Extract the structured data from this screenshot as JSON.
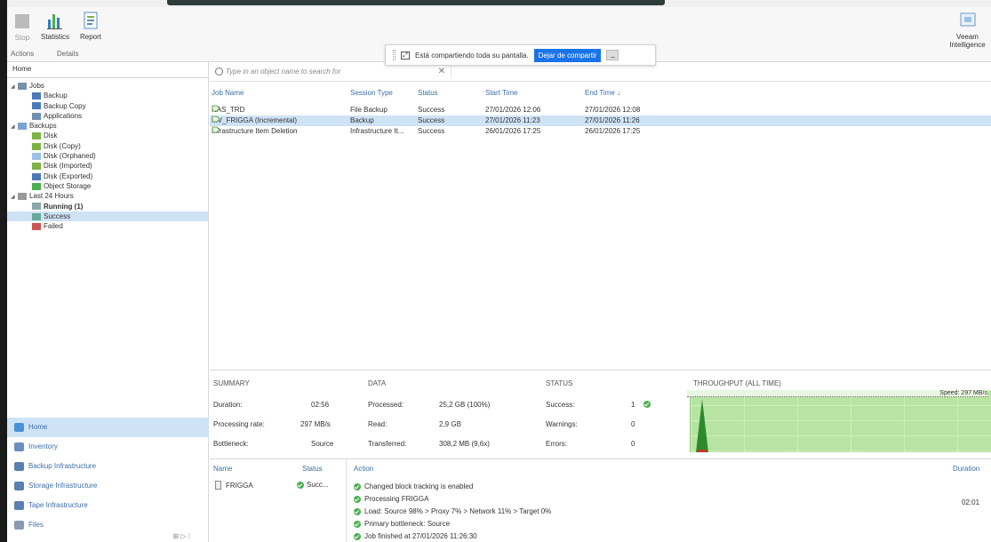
{
  "ribbon": {
    "stop_label": "Stop",
    "statistics_label": "Statistics",
    "report_label": "Report",
    "group_actions": "Actions",
    "group_details": "Details",
    "veeam_label": "Veeam",
    "intelligence_label": "Intelligence"
  },
  "share_bar": {
    "message": "Está compartiendo toda su pantalla.",
    "stop_label": "Dejar de compartir",
    "min_label": "_"
  },
  "sidebar": {
    "header": "Home",
    "tree": [
      {
        "label": "Jobs",
        "level": 0,
        "exp": "◢",
        "color": "#7a8fa8"
      },
      {
        "label": "Backup",
        "level": 1,
        "color": "#4a7ab8"
      },
      {
        "label": "Backup Copy",
        "level": 1,
        "color": "#4a7ab8"
      },
      {
        "label": "Applications",
        "level": 1,
        "color": "#6f8fb0"
      },
      {
        "label": "Backups",
        "level": 0,
        "exp": "◢",
        "color": "#7aa5d0"
      },
      {
        "label": "Disk",
        "level": 1,
        "color": "#7cb342"
      },
      {
        "label": "Disk (Copy)",
        "level": 1,
        "color": "#7cb342"
      },
      {
        "label": "Disk (Orphaned)",
        "level": 1,
        "color": "#9cc3e6"
      },
      {
        "label": "Disk (Imported)",
        "level": 1,
        "color": "#7cb342"
      },
      {
        "label": "Disk (Exported)",
        "level": 1,
        "color": "#4a7ab8"
      },
      {
        "label": "Object Storage",
        "level": 1,
        "color": "#4caf50"
      },
      {
        "label": "Last 24 Hours",
        "level": 0,
        "exp": "◢",
        "color": "#999999"
      },
      {
        "label": "Running (1)",
        "level": 1,
        "bold": true,
        "color": "#8aa"
      },
      {
        "label": "Success",
        "level": 1,
        "selected": true,
        "color": "#6a9"
      },
      {
        "label": "Failed",
        "level": 1,
        "color": "#c55"
      }
    ],
    "nav": [
      {
        "label": "Home",
        "selected": true,
        "color": "#4a90d9"
      },
      {
        "label": "Inventory",
        "color": "#6a8fc0"
      },
      {
        "label": "Backup Infrastructure",
        "color": "#5a7fb0"
      },
      {
        "label": "Storage Infrastructure",
        "color": "#5a7fb0"
      },
      {
        "label": "Tape Infrastructure",
        "color": "#5a7fb0"
      },
      {
        "label": "Files",
        "color": "#8a9ab0"
      }
    ],
    "footer": "⊞ ▷ ⁞"
  },
  "search": {
    "placeholder": "Type in an object name to search for",
    "clear": "✕"
  },
  "jobs": {
    "columns": [
      "Job Name",
      "Session Type",
      "Status",
      "Start Time",
      "End Time ↓"
    ],
    "rows": [
      {
        "name": "NAS_TRD",
        "type": "File Backup",
        "status": "Success",
        "start": "27/01/2026 12:06",
        "end": "27/01/2026 12:08"
      },
      {
        "name": "MV_FRIGGA (Incremental)",
        "type": "Backup",
        "status": "Success",
        "start": "27/01/2026 11:23",
        "end": "27/01/2026 11:26",
        "selected": true
      },
      {
        "name": "Infrastructure Item Deletion",
        "type": "Infrastructure It...",
        "status": "Success",
        "start": "26/01/2026 17:25",
        "end": "26/01/2026 17:25"
      }
    ]
  },
  "summary": {
    "headers": {
      "summary": "SUMMARY",
      "data": "DATA",
      "status": "STATUS",
      "throughput": "THROUGHPUT (ALL TIME)"
    },
    "duration_label": "Duration:",
    "duration_value": "02:56",
    "rate_label": "Processing rate:",
    "rate_value": "297 MB/s",
    "bottleneck_label": "Bottleneck:",
    "bottleneck_value": "Source",
    "processed_label": "Processed:",
    "processed_value": "25,2 GB (100%)",
    "read_label": "Read:",
    "read_value": "2,9 GB",
    "transferred_label": "Transferred:",
    "transferred_value": "308,2 MB (9,6x)",
    "success_label": "Success:",
    "success_value": "1",
    "warnings_label": "Warnings:",
    "warnings_value": "0",
    "errors_label": "Errors:",
    "errors_value": "0",
    "speed_label": "Speed: 297 MB/s"
  },
  "details": {
    "name_header": "Name",
    "status_header": "Status",
    "action_header": "Action",
    "duration_header": "Duration",
    "vm_name": "FRIGGA",
    "vm_status": "Succ...",
    "actions": [
      "Changed block tracking is enabled",
      "Processing FRIGGA",
      "Load: Source 98% > Proxy 7% > Network 11% > Target 0%",
      "Primary bottleneck: Source",
      "Job finished at 27/01/2026 11:26:30"
    ],
    "processing_duration": "02:01"
  }
}
